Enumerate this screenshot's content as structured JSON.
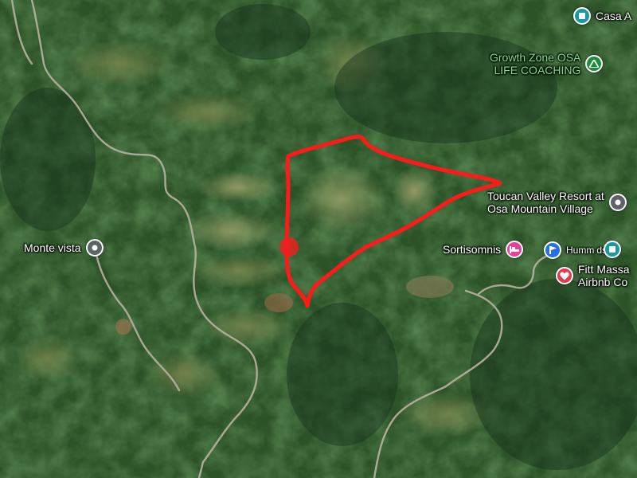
{
  "colors": {
    "forest_dark": "#1f3d20",
    "forest": "#2f5a2c",
    "forest_light": "#4e7a3a",
    "pasture": "#8a8a5a",
    "clearing": "#9aa06a",
    "road": "#b9b2a2",
    "boundary": "#ff1a1a",
    "pin_teal": "#1a9aa0",
    "pin_green": "#1e8e3e",
    "pin_pink": "#e8409a",
    "pin_blue": "#2a6fdb",
    "pin_red": "#e53950",
    "pin_gray": "#5f6368"
  },
  "places": {
    "casa": {
      "label": "Casa A",
      "icon": "square-icon"
    },
    "growth_zone": {
      "line1": "Growth Zone OSA",
      "line2": "LIFE COACHING",
      "icon": "triangle-icon"
    },
    "toucan": {
      "line1": "Toucan Valley Resort at",
      "line2": "Osa Mountain Village",
      "icon": "pin-icon"
    },
    "monte_vista": {
      "label": "Monte vista",
      "icon": "pin-icon"
    },
    "sortisomnis": {
      "label": "Sortisomnis",
      "icon": "bed-icon"
    },
    "humm": {
      "label": "Humm",
      "suffix": "ds",
      "icon": "flag-icon"
    },
    "fitt": {
      "line1": "Fitt Massa",
      "line2": "Airbnb Co",
      "icon": "heart-icon"
    },
    "teal_square": {
      "icon": "square-icon"
    }
  }
}
